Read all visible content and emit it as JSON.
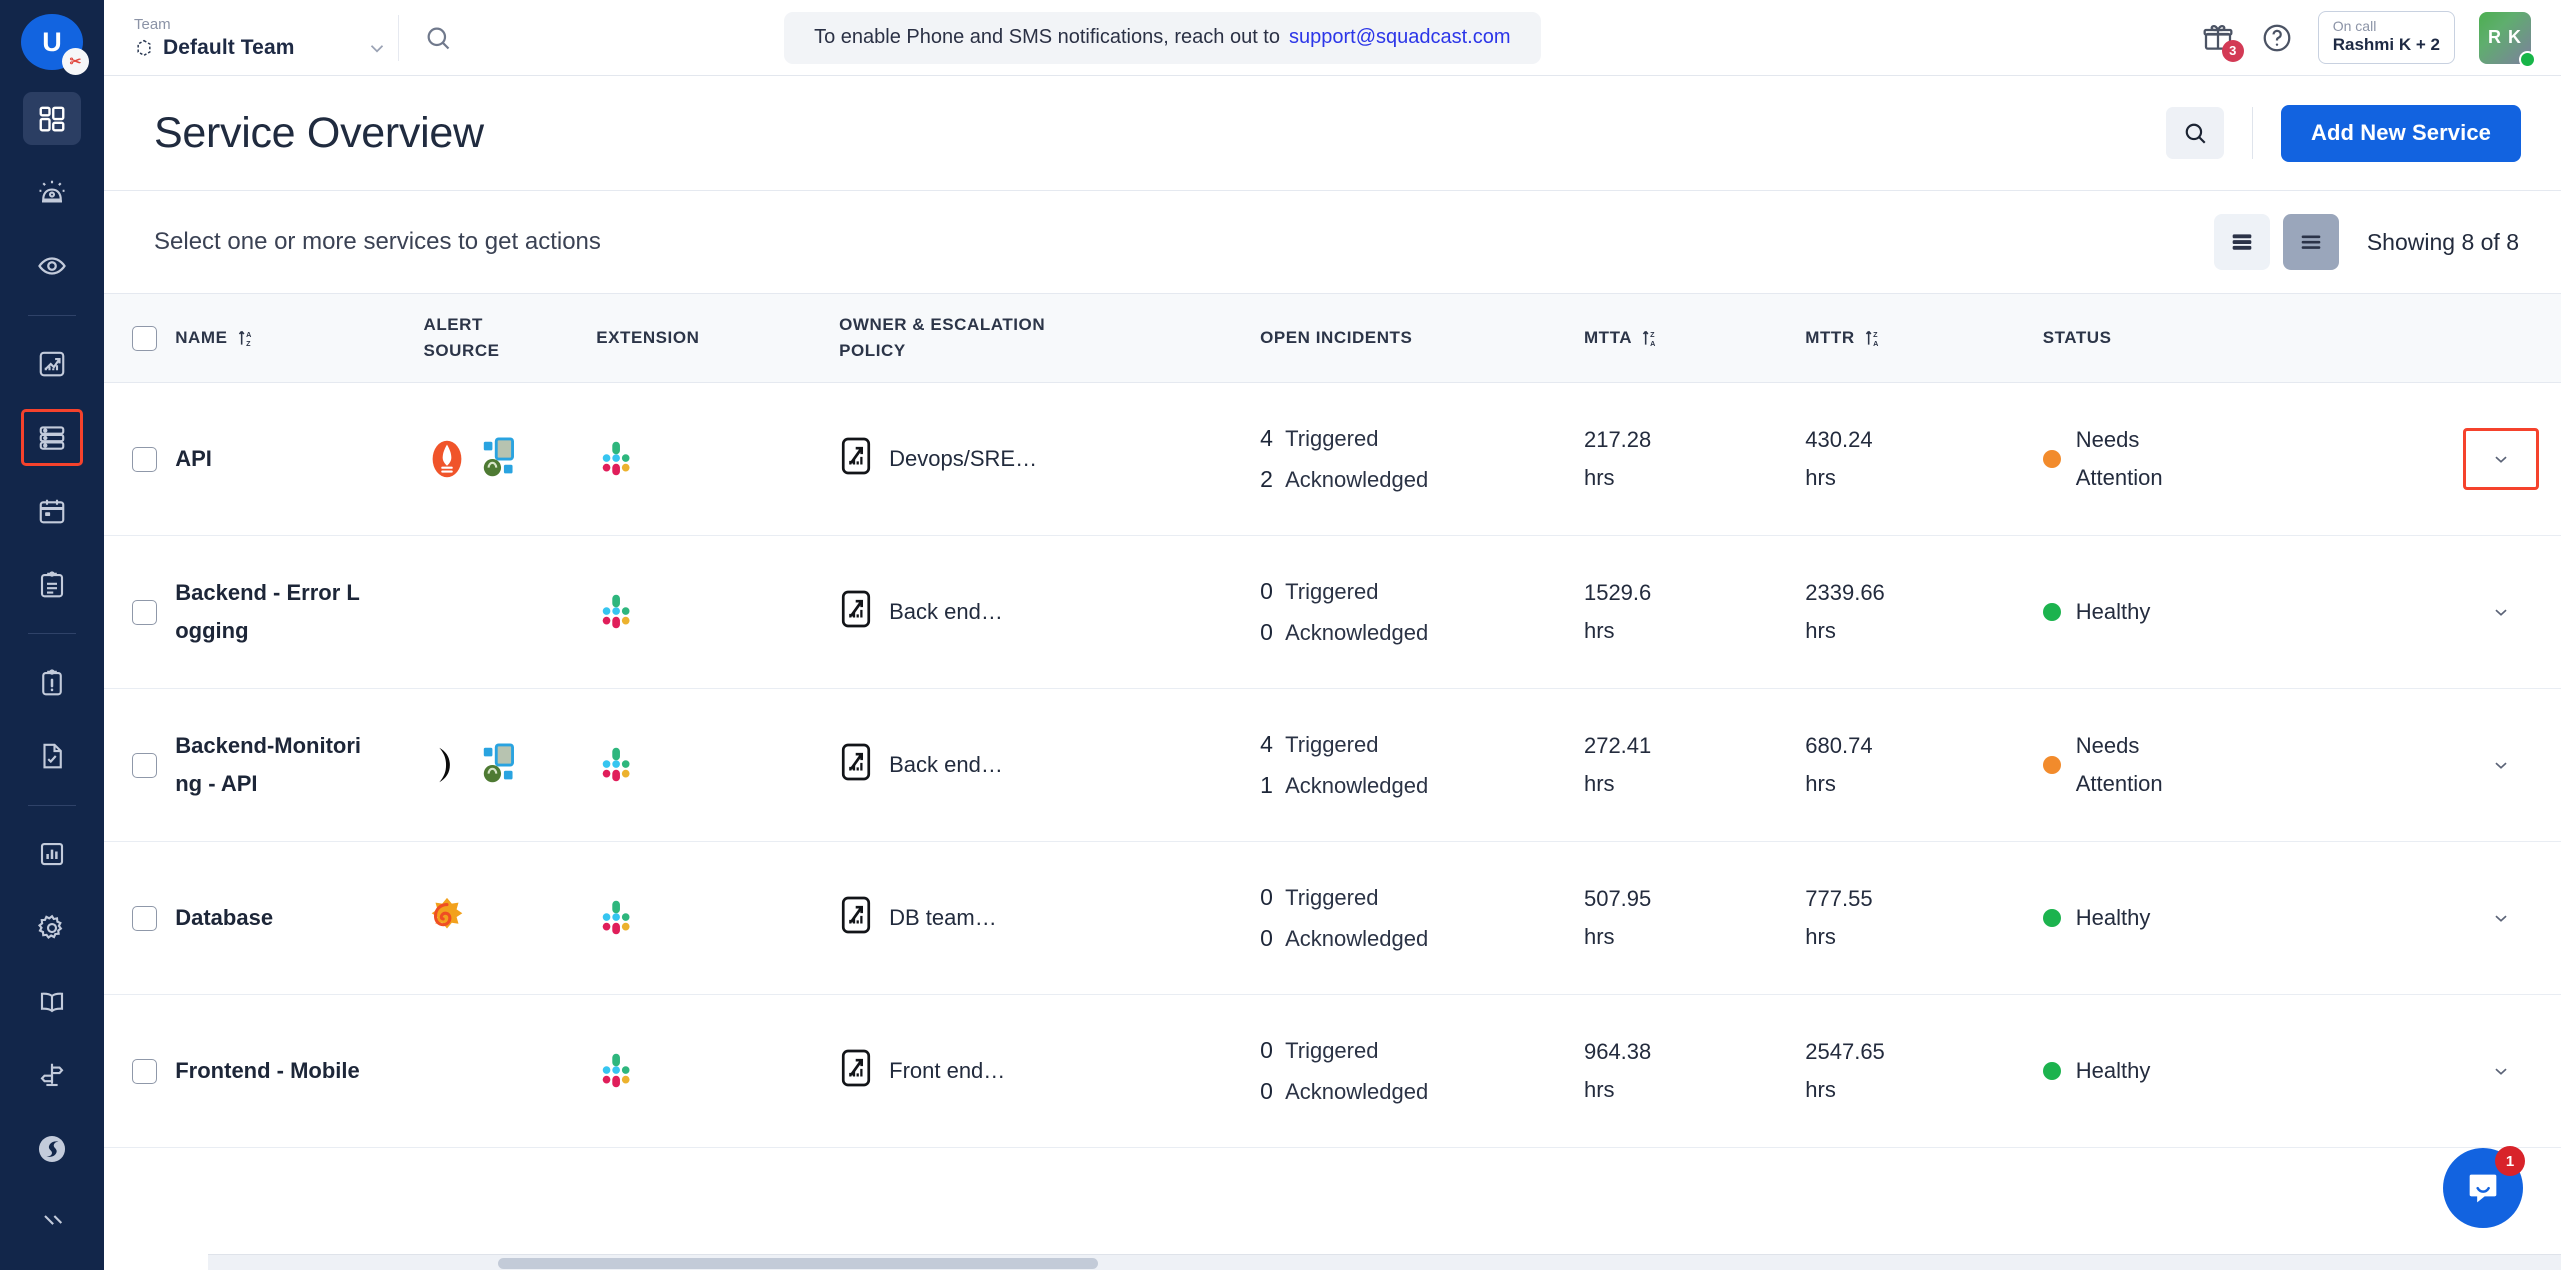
{
  "rail": {
    "logo": {
      "initial": "U",
      "badge": "✂"
    },
    "items": [
      {
        "name": "dashboard",
        "icon": "grid-dashboard-icon",
        "active": true
      },
      {
        "name": "incidents",
        "icon": "alarm-bell-icon",
        "active": false
      },
      {
        "name": "watchlist",
        "icon": "eye-icon",
        "active": false
      },
      {
        "name": "analytics",
        "icon": "trending-chart-icon",
        "active": false
      },
      {
        "name": "services",
        "icon": "server-stack-icon",
        "active": false,
        "focused": true
      },
      {
        "name": "schedules",
        "icon": "calendar-icon",
        "active": false
      },
      {
        "name": "runbooks",
        "icon": "clipboard-lines-icon",
        "active": false
      },
      {
        "name": "postmortems",
        "icon": "clipboard-alert-icon",
        "active": false
      },
      {
        "name": "status-page",
        "icon": "file-check-icon",
        "active": false
      },
      {
        "name": "reports",
        "icon": "bar-chart-box-icon",
        "active": false
      },
      {
        "name": "settings",
        "icon": "gear-icon",
        "active": false
      },
      {
        "name": "docs",
        "icon": "open-book-icon",
        "active": false
      },
      {
        "name": "guides",
        "icon": "signpost-icon",
        "active": false
      },
      {
        "name": "squadcast",
        "icon": "squadcast-logo-icon",
        "active": false
      }
    ]
  },
  "topbar": {
    "team_label": "Team",
    "team_value": "Default Team",
    "banner_text": "To enable Phone and SMS notifications, reach out to",
    "banner_link": "support@squadcast.com",
    "gift_badge": "3",
    "oncall_label": "On call",
    "oncall_value": "Rashmi K + 2",
    "avatar_initials": "R K"
  },
  "page": {
    "title": "Service Overview",
    "add_button": "Add New Service",
    "select_hint": "Select one or more services to get actions",
    "showing": "Showing 8 of 8"
  },
  "table": {
    "columns": [
      {
        "key": "checkbox",
        "label": ""
      },
      {
        "key": "name",
        "label": "NAME",
        "sort": "az"
      },
      {
        "key": "alert_source",
        "label": "ALERT SOURCE"
      },
      {
        "key": "extension",
        "label": "EXTENSION"
      },
      {
        "key": "owner",
        "label": "OWNER & ESCALATION POLICY"
      },
      {
        "key": "open_incidents",
        "label": "OPEN INCIDENTS"
      },
      {
        "key": "mtta",
        "label": "MTTA",
        "sort": "za"
      },
      {
        "key": "mttr",
        "label": "MTTR",
        "sort": "za"
      },
      {
        "key": "status",
        "label": "STATUS"
      },
      {
        "key": "expand",
        "label": ""
      }
    ],
    "labels": {
      "triggered": "Triggered",
      "acknowledged": "Acknowledged",
      "hrs": "hrs"
    },
    "rows": [
      {
        "name": "API",
        "alert_sources": [
          "sensu-icon",
          "kubernetes-grid-icon"
        ],
        "extensions": [
          "slack-icon"
        ],
        "owner": "Devops/SRE…",
        "triggered": "4",
        "acknowledged": "2",
        "mtta": "217.28",
        "mttr": "430.24",
        "status": "Needs Attention",
        "status_color": "#f28b2c",
        "expander_focused": true
      },
      {
        "name": "Backend - Error Logging",
        "alert_sources": [],
        "extensions": [
          "slack-icon"
        ],
        "owner": "Back end…",
        "triggered": "0",
        "acknowledged": "0",
        "mtta": "1529.6",
        "mttr": "2339.66",
        "status": "Healthy",
        "status_color": "#1cb34e",
        "expander_focused": false
      },
      {
        "name": "Backend-Monitoring - API",
        "alert_sources": [
          "newrelic-icon",
          "kubernetes-grid-icon"
        ],
        "extensions": [
          "slack-icon"
        ],
        "owner": "Back end…",
        "triggered": "4",
        "acknowledged": "1",
        "mtta": "272.41",
        "mttr": "680.74",
        "status": "Needs Attention",
        "status_color": "#f28b2c",
        "expander_focused": false
      },
      {
        "name": "Database",
        "alert_sources": [
          "grafana-icon"
        ],
        "extensions": [
          "slack-icon"
        ],
        "owner": "DB team…",
        "triggered": "0",
        "acknowledged": "0",
        "mtta": "507.95",
        "mttr": "777.55",
        "status": "Healthy",
        "status_color": "#1cb34e",
        "expander_focused": false
      },
      {
        "name": "Frontend - Mobile",
        "alert_sources": [],
        "extensions": [
          "slack-icon"
        ],
        "owner": "Front end…",
        "triggered": "0",
        "acknowledged": "0",
        "mtta": "964.38",
        "mttr": "2547.65",
        "status": "Healthy",
        "status_color": "#1cb34e",
        "expander_focused": false
      }
    ]
  },
  "intercom": {
    "badge": "1"
  }
}
